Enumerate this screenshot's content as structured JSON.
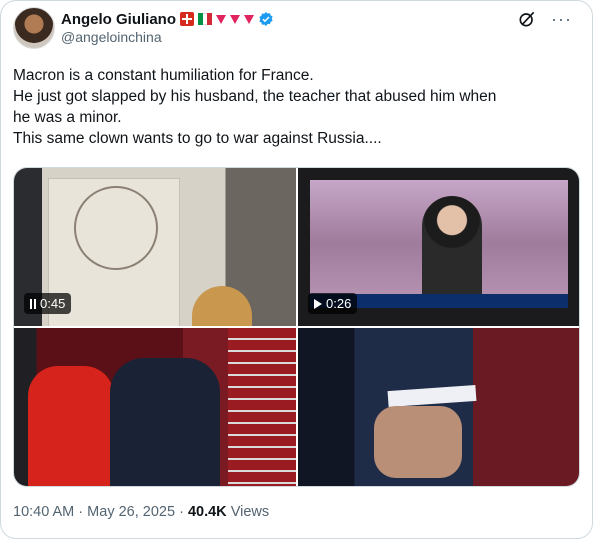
{
  "author": {
    "display_name": "Angelo Giuliano",
    "handle": "@angeloinchina",
    "badge_icons": [
      "swiss-flag-icon",
      "italian-flag-icon",
      "red-triangle-icon",
      "red-triangle-icon",
      "red-triangle-icon",
      "verified-badge-icon"
    ],
    "verified_color": "#1d9bf0"
  },
  "tweet": {
    "lines": [
      "Macron is a constant humiliation for France.",
      "He just got slapped by his husband, the teacher that abused him when",
      "he was a minor.",
      "This same clown wants to go to war against Russia...."
    ]
  },
  "media": {
    "tiles": [
      {
        "type": "video",
        "duration": "0:45",
        "control_icon": "pause-icon"
      },
      {
        "type": "video",
        "duration": "0:26",
        "control_icon": "play-icon"
      },
      {
        "type": "image"
      },
      {
        "type": "image"
      }
    ]
  },
  "footer": {
    "time": "10:40 AM",
    "separator": "·",
    "date": "May 26, 2025",
    "views_count": "40.4K",
    "views_label": "Views"
  },
  "icons": {
    "grok": "grok-icon",
    "more": "more-options-icon"
  },
  "colors": {
    "secondary_text": "#536471",
    "border": "#cfd9de"
  }
}
